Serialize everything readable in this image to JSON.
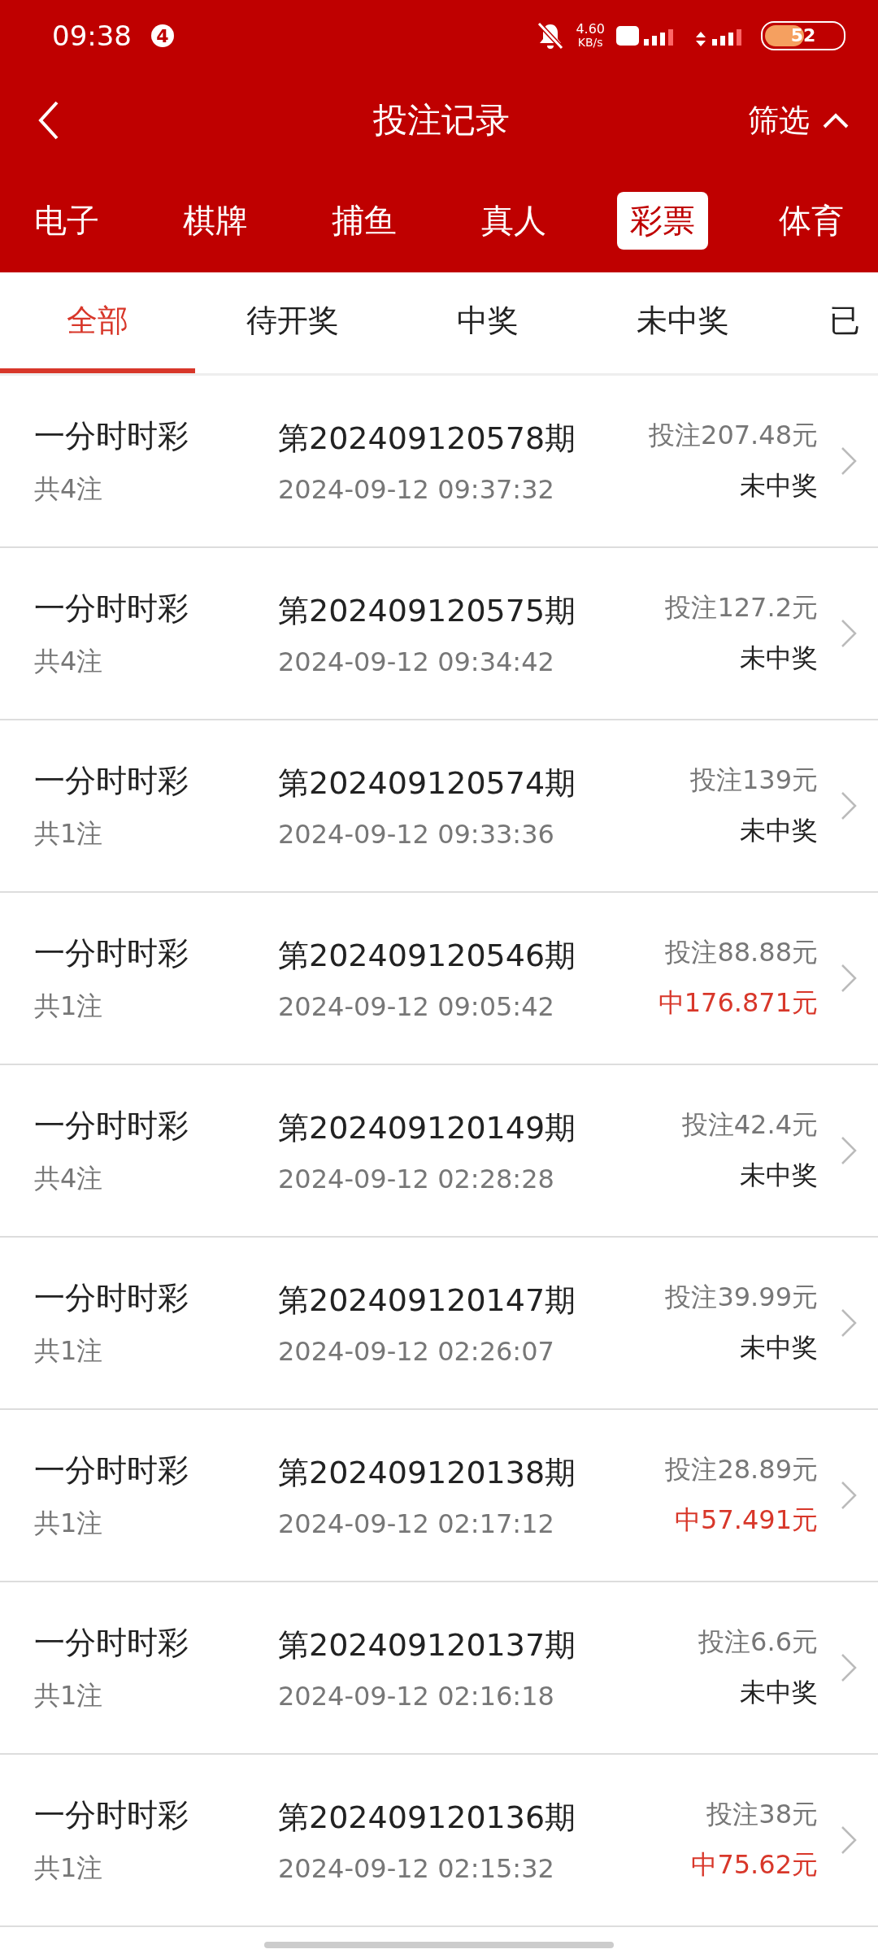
{
  "status_bar": {
    "time": "09:38",
    "notification_count": "4",
    "speed": "4.60",
    "speed_unit": "KB/s",
    "battery": "52"
  },
  "header": {
    "title": "投注记录",
    "filter": "筛选"
  },
  "categories": [
    {
      "label": "电子",
      "selected": false
    },
    {
      "label": "棋牌",
      "selected": false
    },
    {
      "label": "捕鱼",
      "selected": false
    },
    {
      "label": "真人",
      "selected": false
    },
    {
      "label": "彩票",
      "selected": true
    },
    {
      "label": "体育",
      "selected": false
    }
  ],
  "tabs": [
    {
      "label": "全部",
      "selected": true
    },
    {
      "label": "待开奖",
      "selected": false
    },
    {
      "label": "中奖",
      "selected": false
    },
    {
      "label": "未中奖",
      "selected": false
    },
    {
      "label": "已",
      "selected": false
    }
  ],
  "records": [
    {
      "game": "一分时时彩",
      "count": "共4注",
      "period": "第202409120578期",
      "time": "2024-09-12 09:37:32",
      "bet": "投注207.48元",
      "result": "未中奖",
      "won": false
    },
    {
      "game": "一分时时彩",
      "count": "共4注",
      "period": "第202409120575期",
      "time": "2024-09-12 09:34:42",
      "bet": "投注127.2元",
      "result": "未中奖",
      "won": false
    },
    {
      "game": "一分时时彩",
      "count": "共1注",
      "period": "第202409120574期",
      "time": "2024-09-12 09:33:36",
      "bet": "投注139元",
      "result": "未中奖",
      "won": false
    },
    {
      "game": "一分时时彩",
      "count": "共1注",
      "period": "第202409120546期",
      "time": "2024-09-12 09:05:42",
      "bet": "投注88.88元",
      "result": "中176.871元",
      "won": true
    },
    {
      "game": "一分时时彩",
      "count": "共4注",
      "period": "第202409120149期",
      "time": "2024-09-12 02:28:28",
      "bet": "投注42.4元",
      "result": "未中奖",
      "won": false
    },
    {
      "game": "一分时时彩",
      "count": "共1注",
      "period": "第202409120147期",
      "time": "2024-09-12 02:26:07",
      "bet": "投注39.99元",
      "result": "未中奖",
      "won": false
    },
    {
      "game": "一分时时彩",
      "count": "共1注",
      "period": "第202409120138期",
      "time": "2024-09-12 02:17:12",
      "bet": "投注28.89元",
      "result": "中57.491元",
      "won": true
    },
    {
      "game": "一分时时彩",
      "count": "共1注",
      "period": "第202409120137期",
      "time": "2024-09-12 02:16:18",
      "bet": "投注6.6元",
      "result": "未中奖",
      "won": false
    },
    {
      "game": "一分时时彩",
      "count": "共1注",
      "period": "第202409120136期",
      "time": "2024-09-12 02:15:32",
      "bet": "投注38元",
      "result": "中75.62元",
      "won": true
    }
  ]
}
